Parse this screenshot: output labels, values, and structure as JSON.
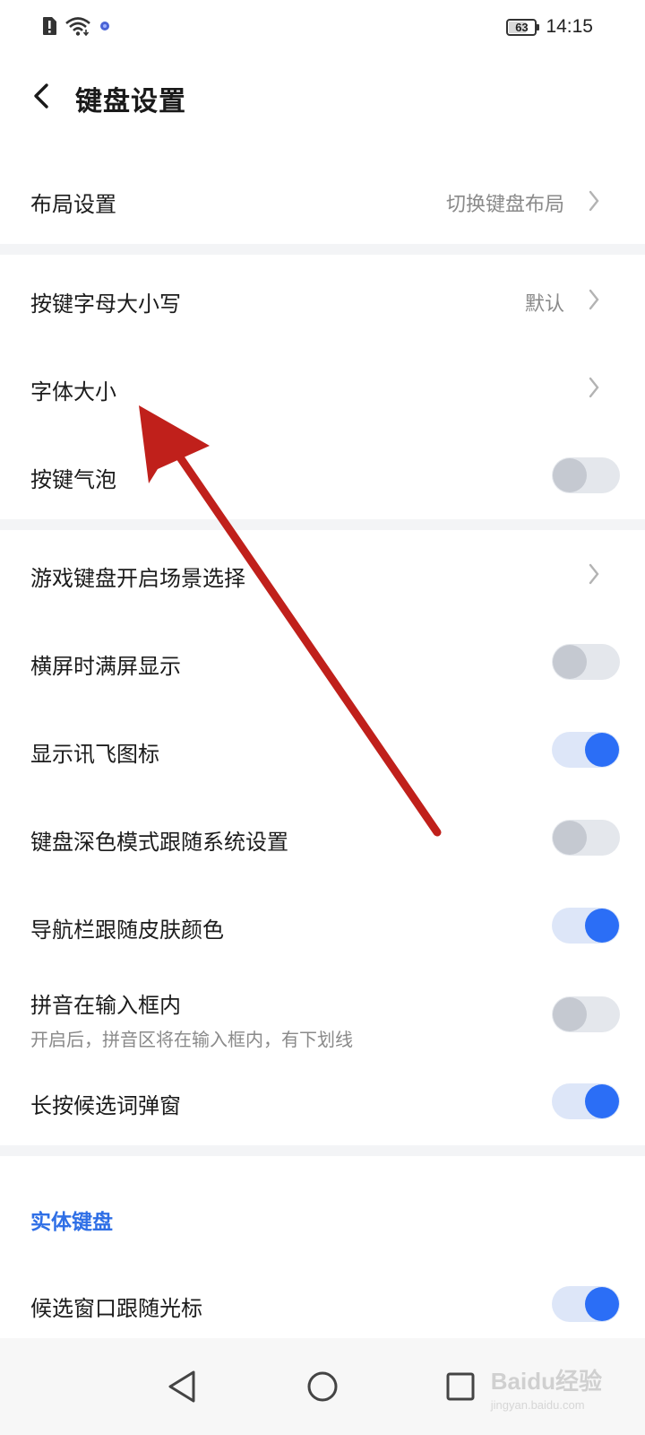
{
  "status_bar": {
    "battery": "63",
    "time": "14:15",
    "icons": [
      "alert-sim-icon",
      "wifi-icon",
      "app-notification-icon"
    ]
  },
  "header": {
    "title": "键盘设置"
  },
  "settings": {
    "layout": {
      "label": "布局设置",
      "value": "切换键盘布局"
    },
    "key_case": {
      "label": "按键字母大小写",
      "value": "默认"
    },
    "font_size": {
      "label": "字体大小"
    },
    "key_bubble": {
      "label": "按键气泡",
      "on": false
    },
    "game_keyboard": {
      "label": "游戏键盘开启场景选择"
    },
    "landscape_fullscreen": {
      "label": "横屏时满屏显示",
      "on": false
    },
    "show_icon": {
      "label": "显示讯飞图标",
      "on": true
    },
    "dark_mode": {
      "label": "键盘深色模式跟随系统设置",
      "on": false
    },
    "navbar_skin": {
      "label": "导航栏跟随皮肤颜色",
      "on": true
    },
    "pinyin_inline": {
      "label": "拼音在输入框内",
      "sub": "开启后，拼音区将在输入框内，有下划线",
      "on": false
    },
    "long_press_popup": {
      "label": "长按候选词弹窗",
      "on": true
    }
  },
  "physical_keyboard": {
    "title": "实体键盘",
    "candidate_follow": {
      "label": "候选窗口跟随光标",
      "on": true
    }
  },
  "watermark": {
    "brand": "Baidu经验",
    "url": "jingyan.baidu.com"
  },
  "colors": {
    "accent": "#2b6ef6",
    "section_title": "#2f6fe6",
    "annotation_arrow": "#c0201b"
  }
}
